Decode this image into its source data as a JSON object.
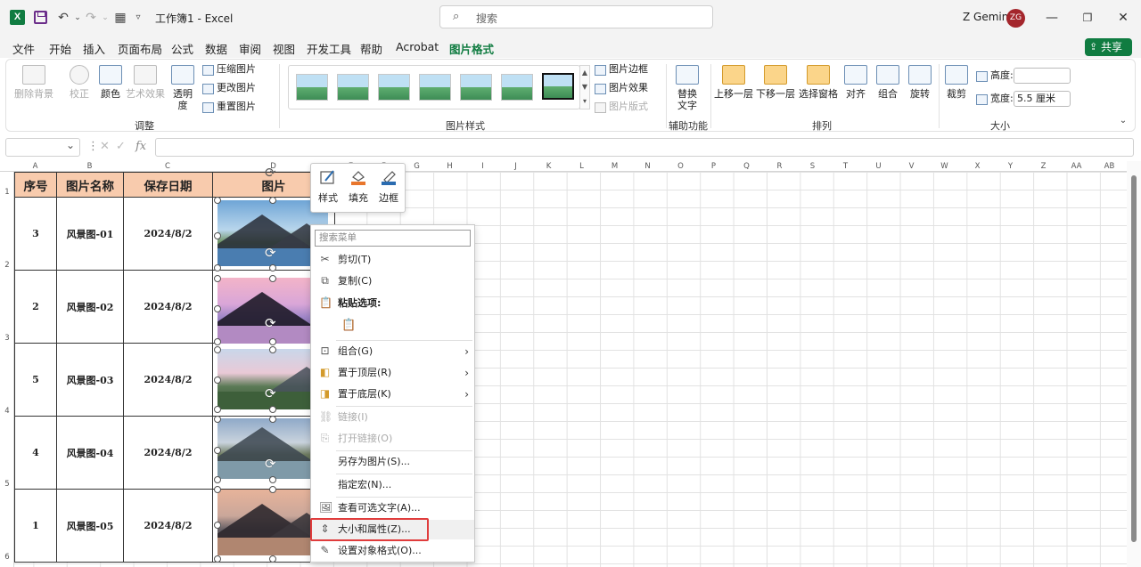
{
  "titlebar": {
    "app_icon": "X",
    "doc_title": "工作簿1  -  Excel",
    "search_placeholder": "搜索",
    "user_name": "Z Gemini",
    "avatar_initials": "ZG"
  },
  "menu": {
    "items": [
      "文件",
      "开始",
      "插入",
      "页面布局",
      "公式",
      "数据",
      "审阅",
      "视图",
      "开发工具",
      "帮助",
      "Acrobat",
      "图片格式"
    ],
    "active": "图片格式",
    "share_label": "共享"
  },
  "ribbon": {
    "adjust": {
      "remove_bg": "删除背景",
      "correct": "校正",
      "color": "颜色",
      "artistic": "艺术效果",
      "transparency": "透明\n度",
      "compress": "压缩图片",
      "change": "更改图片",
      "reset": "重置图片",
      "group_label": "调整"
    },
    "styles": {
      "group_label": "图片样式",
      "border": "图片边框",
      "effects": "图片效果",
      "layout": "图片版式"
    },
    "accessibility": {
      "alt_text": "替换\n文字",
      "group_label": "辅助功能"
    },
    "arrange": {
      "bring_forward": "上移一层",
      "send_backward": "下移一层",
      "selection_pane": "选择窗格",
      "align": "对齐",
      "group": "组合",
      "rotate": "旋转",
      "group_label": "排列"
    },
    "size": {
      "crop": "裁剪",
      "height_label": "高度:",
      "height_value": "",
      "width_label": "宽度:",
      "width_value": "5.5 厘米",
      "group_label": "大小"
    }
  },
  "formula_bar": {
    "fx": "fx"
  },
  "columns": [
    "A",
    "B",
    "C",
    "D",
    "E",
    "F",
    "G",
    "H",
    "I",
    "J",
    "K",
    "L",
    "M",
    "N",
    "O",
    "P",
    "Q",
    "R",
    "S",
    "T",
    "U",
    "V",
    "W",
    "X",
    "Y",
    "Z",
    "AA",
    "AB"
  ],
  "rows": [
    "1",
    "2",
    "3",
    "4",
    "5",
    "6"
  ],
  "table": {
    "headers": [
      "序号",
      "图片名称",
      "保存日期",
      "图片"
    ],
    "rows": [
      {
        "no": "3",
        "name": "风景图-01",
        "date": "2024/8/2"
      },
      {
        "no": "2",
        "name": "风景图-02",
        "date": "2024/8/2"
      },
      {
        "no": "5",
        "name": "风景图-03",
        "date": "2024/8/2"
      },
      {
        "no": "4",
        "name": "风景图-04",
        "date": "2024/8/2"
      },
      {
        "no": "1",
        "name": "风景图-05",
        "date": "2024/8/2"
      }
    ]
  },
  "mini_toolbar": {
    "style": "样式",
    "fill": "填充",
    "border": "边框"
  },
  "context_menu": {
    "search_placeholder": "搜索菜单",
    "cut": "剪切(T)",
    "copy": "复制(C)",
    "paste_options": "粘贴选项:",
    "group": "组合(G)",
    "bring_to_front": "置于顶层(R)",
    "send_to_back": "置于底层(K)",
    "link": "链接(I)",
    "open_link": "打开链接(O)",
    "save_as_picture": "另存为图片(S)...",
    "assign_macro": "指定宏(N)...",
    "view_alt_text": "查看可选文字(A)...",
    "size_and_properties": "大小和属性(Z)...",
    "format_object": "设置对象格式(O)..."
  },
  "colors": {
    "accent": "#107c41",
    "header_fill": "#f8cbad",
    "highlight_box": "#e03c3c"
  }
}
